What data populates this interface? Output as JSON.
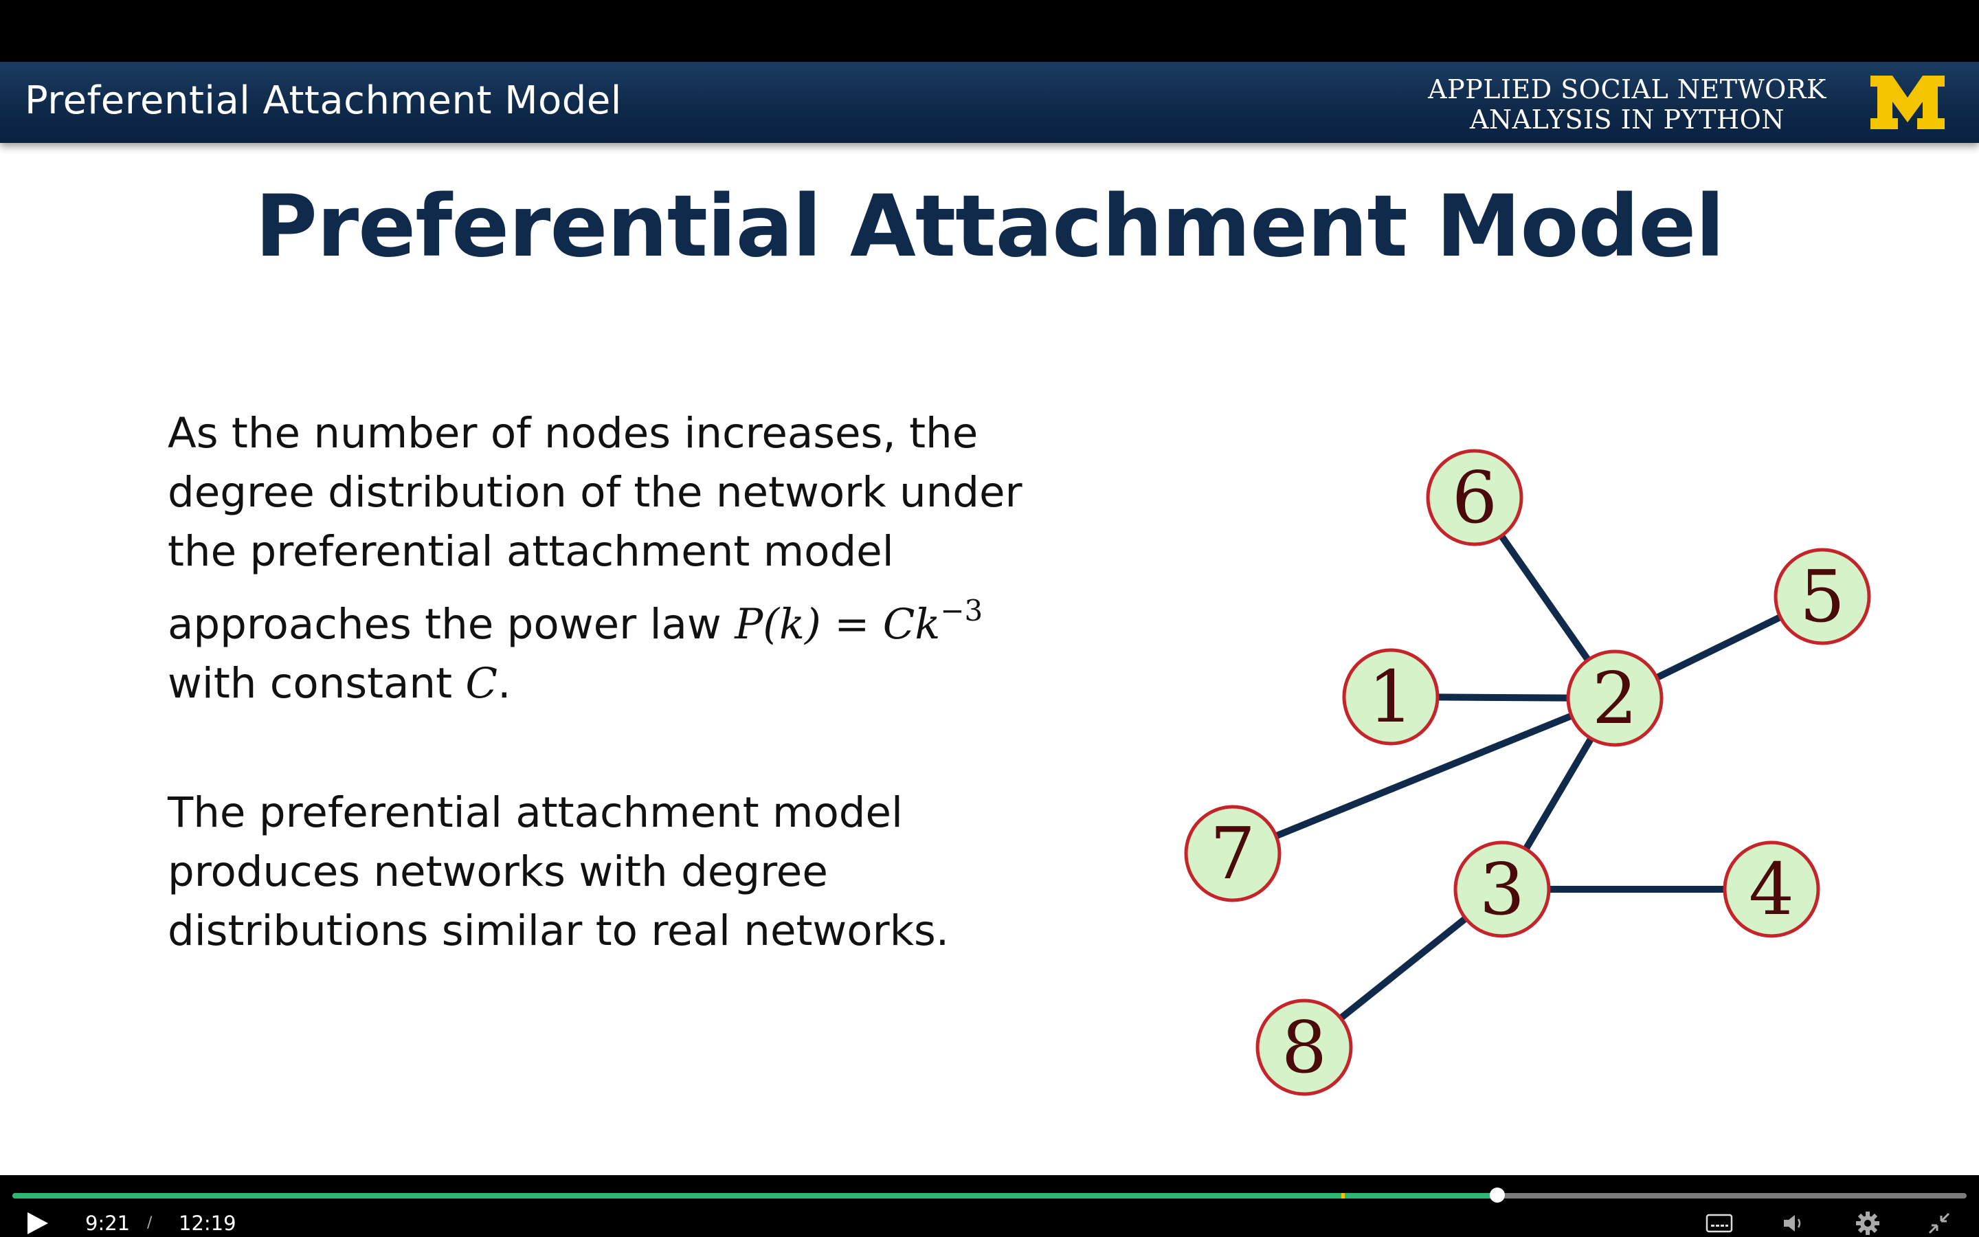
{
  "header": {
    "banner_title": "Preferential Attachment Model",
    "course_line1": "APPLIED SOCIAL NETWORK",
    "course_line2": "ANALYSIS IN PYTHON",
    "logo_letter": "M",
    "brand_colors": {
      "navy": "#0f2a4a",
      "maize": "#f5c400"
    }
  },
  "slide": {
    "title": "Preferential Attachment Model",
    "paragraph1": {
      "text_before": "As the number of nodes increases, the degree distribution of the network under the preferential attachment model approaches the power law ",
      "formula_lhs": "P(k)",
      "formula_eq": " = ",
      "formula_rhs": "Ck",
      "formula_exponent": "−3",
      "text_after": "with constant ",
      "constant": "C",
      "period": "."
    },
    "paragraph2": "The preferential attachment model produces networks with degree distributions similar to real networks."
  },
  "graph": {
    "node_colors": {
      "fill": "#d6f2c8",
      "stroke": "#c4242a",
      "label": "#4a0a0a",
      "edge": "#0f2a4a"
    },
    "nodes": [
      "1",
      "2",
      "3",
      "4",
      "5",
      "6",
      "7",
      "8"
    ],
    "edges": [
      [
        "2",
        "6"
      ],
      [
        "2",
        "1"
      ],
      [
        "2",
        "5"
      ],
      [
        "2",
        "7"
      ],
      [
        "2",
        "3"
      ],
      [
        "3",
        "4"
      ],
      [
        "3",
        "8"
      ]
    ]
  },
  "player": {
    "current_time": "9:21",
    "separator": "/",
    "total_time": "12:19",
    "progress_fraction": 0.76,
    "buffered_marker_fraction": 0.68,
    "icons": [
      "play-icon",
      "captions-icon",
      "volume-icon",
      "settings-icon",
      "exit-fullscreen-icon"
    ]
  }
}
